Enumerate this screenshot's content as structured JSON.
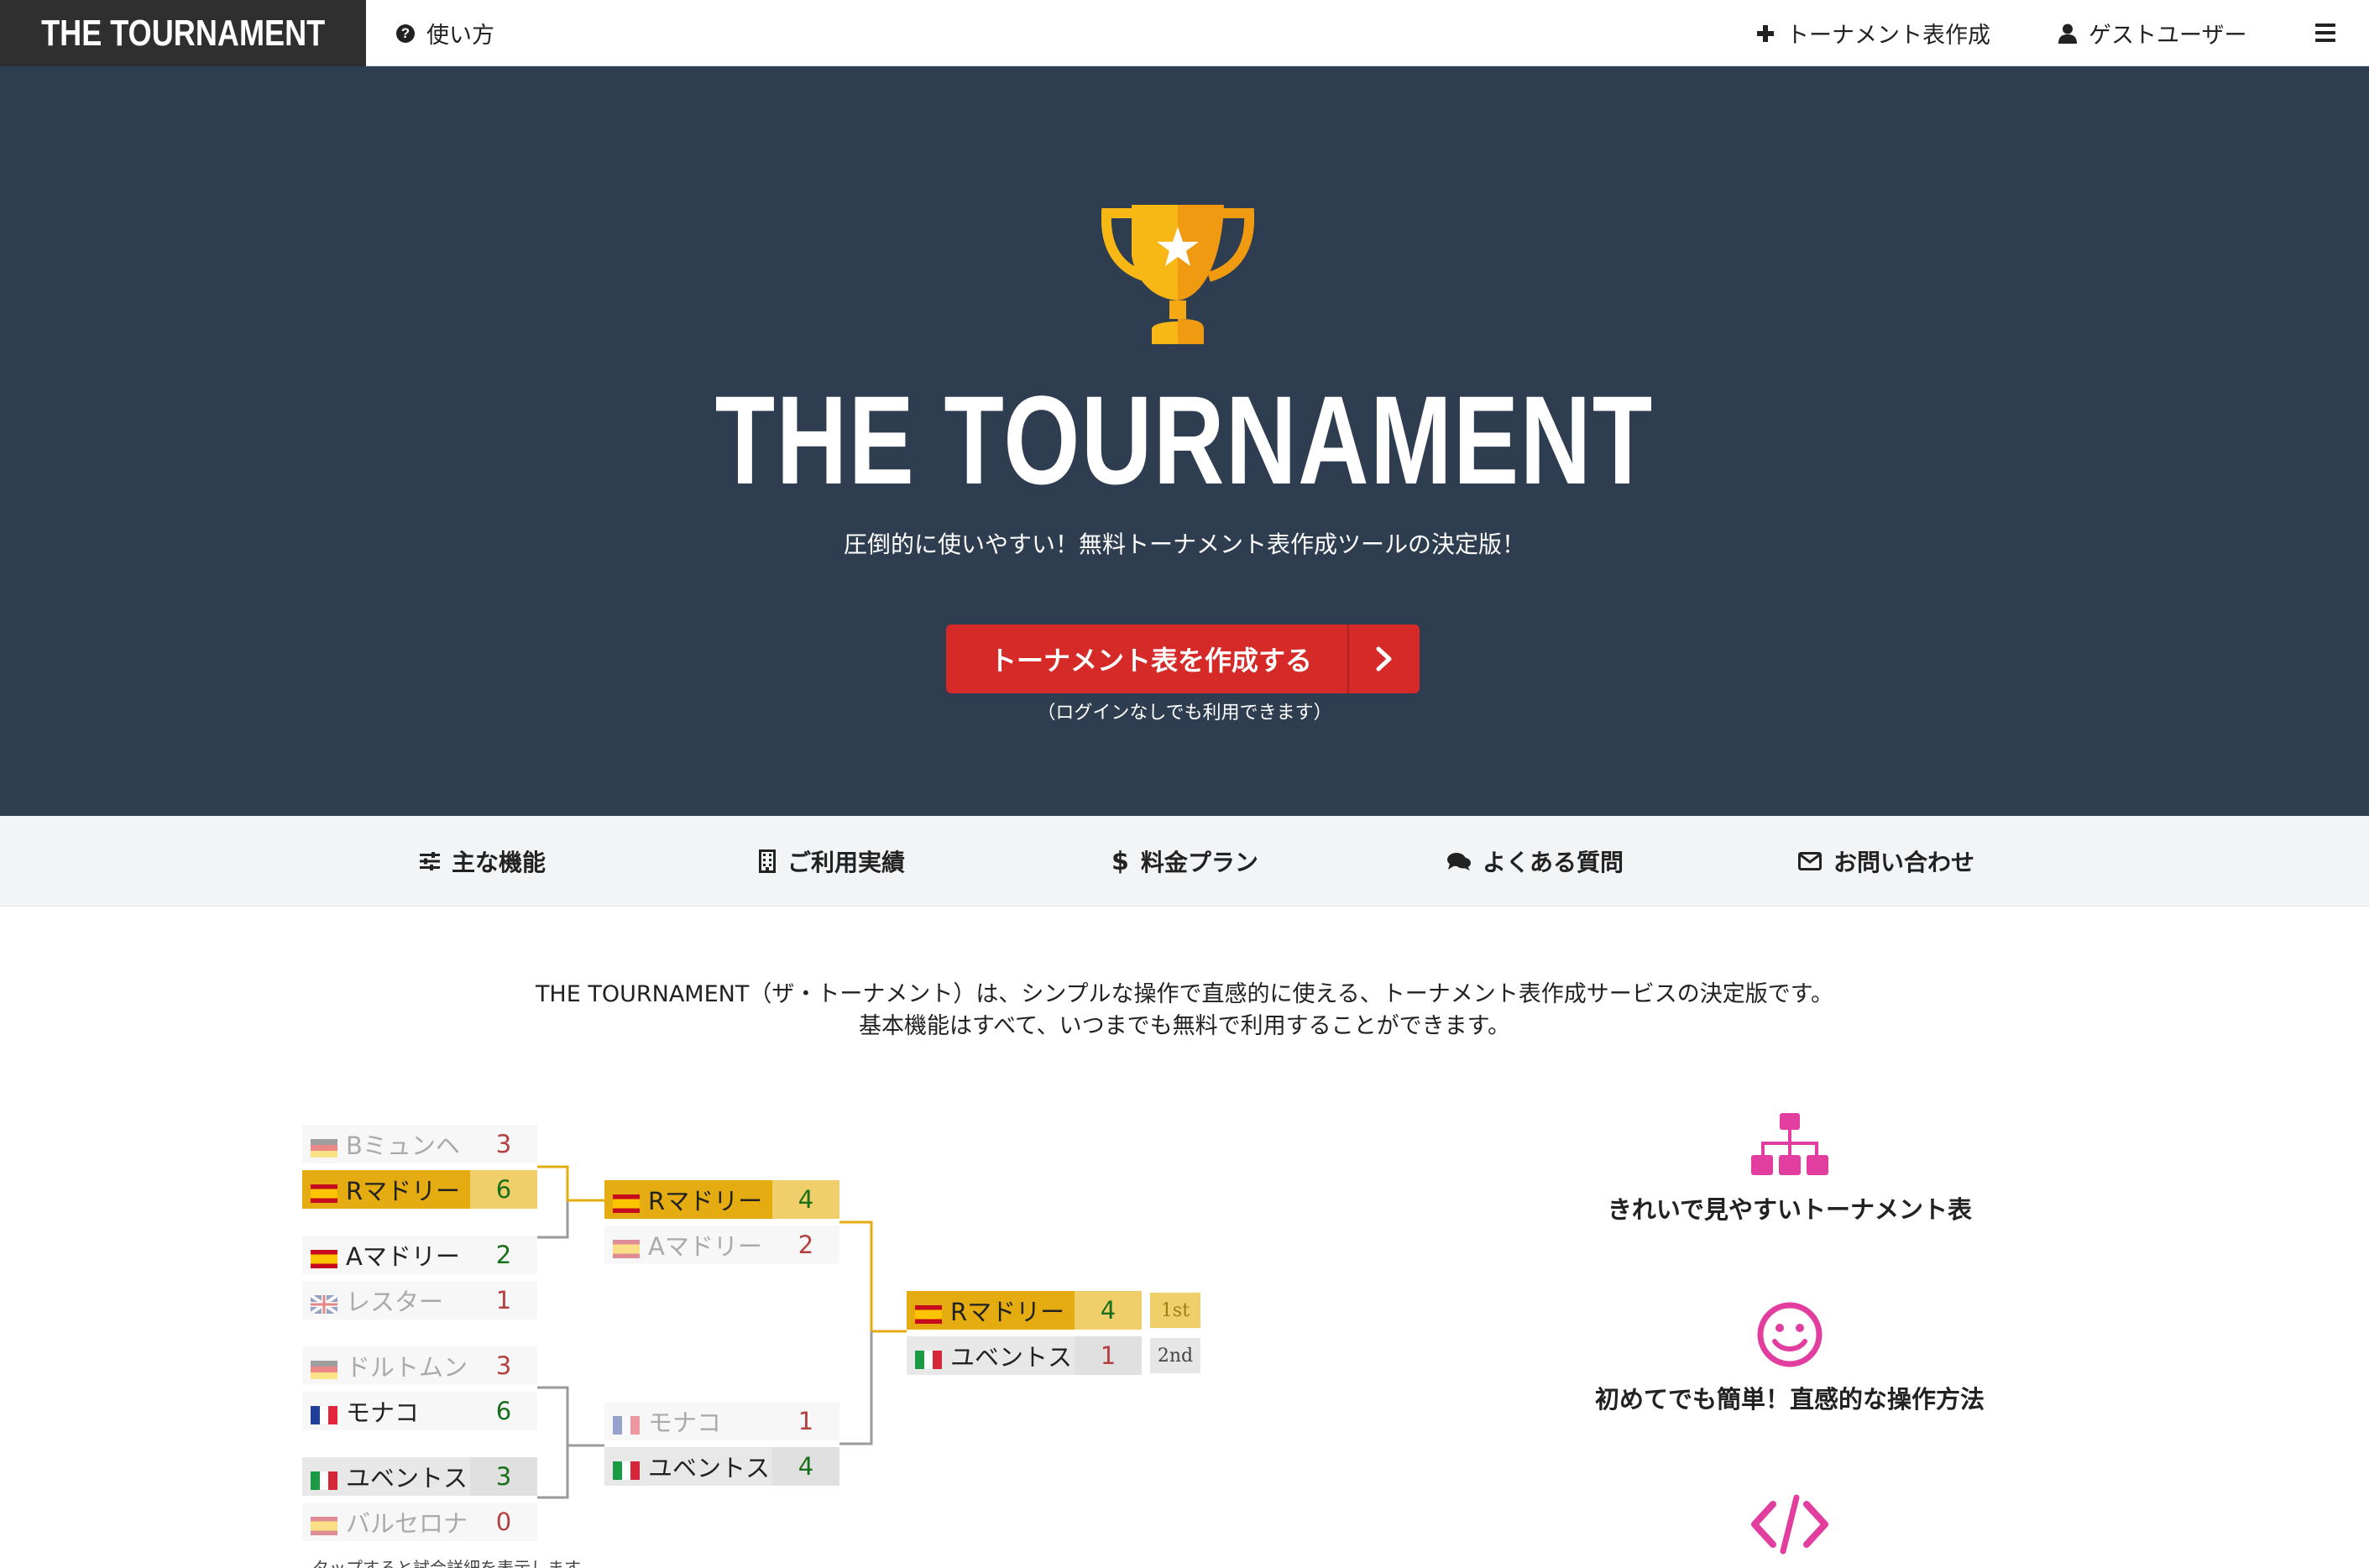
{
  "nav": {
    "brand": "THE TOURNAMENT",
    "help": "使い方",
    "create": "トーナメント表作成",
    "user": "ゲストユーザー",
    "menu_icon": "hamburger-menu-icon"
  },
  "hero": {
    "title": "THE TOURNAMENT",
    "subtitle": "圧倒的に使いやすい！無料トーナメント表作成ツールの決定版！",
    "cta": "トーナメント表を作成する",
    "cta_note": "（ログインなしでも利用できます）",
    "background": "#2e3d4f",
    "cta_color": "#d52a28",
    "trophy_colors": [
      "#f7b815",
      "#f09a12"
    ]
  },
  "subnav": {
    "items": [
      {
        "label": "主な機能",
        "icon": "sliders-icon"
      },
      {
        "label": "ご利用実績",
        "icon": "building-icon"
      },
      {
        "label": "料金プラン",
        "icon": "dollar-icon"
      },
      {
        "label": "よくある質問",
        "icon": "comments-icon"
      },
      {
        "label": "お問い合わせ",
        "icon": "envelope-icon"
      }
    ]
  },
  "intro": {
    "line1": "THE TOURNAMENT（ザ・トーナメント）は、シンプルな操作で直感的に使える、トーナメント表作成サービスの決定版です。",
    "line2": "基本機能はすべて、いつまでも無料で利用することができます。"
  },
  "bracket": {
    "round1": [
      {
        "name": "Bミュンヘ",
        "score": "3",
        "flag": "de",
        "state": "lose"
      },
      {
        "name": "Rマドリー",
        "score": "6",
        "flag": "es",
        "state": "champ"
      },
      {
        "name": "Aマドリー",
        "score": "2",
        "flag": "es",
        "state": "win"
      },
      {
        "name": "レスター",
        "score": "1",
        "flag": "gb",
        "state": "lose"
      },
      {
        "name": "ドルトムン",
        "score": "3",
        "flag": "de",
        "state": "lose"
      },
      {
        "name": "モナコ",
        "score": "6",
        "flag": "fr",
        "state": "win"
      },
      {
        "name": "ユベントス",
        "score": "3",
        "flag": "it",
        "state": "win"
      },
      {
        "name": "バルセロナ",
        "score": "0",
        "flag": "es",
        "state": "lose"
      }
    ],
    "round2": [
      {
        "name": "Rマドリー",
        "score": "4",
        "flag": "es",
        "state": "champ"
      },
      {
        "name": "Aマドリー",
        "score": "2",
        "flag": "es",
        "state": "lose"
      },
      {
        "name": "モナコ",
        "score": "1",
        "flag": "fr",
        "state": "lose"
      },
      {
        "name": "ユベントス",
        "score": "4",
        "flag": "it",
        "state": "win"
      }
    ],
    "final": [
      {
        "name": "Rマドリー",
        "score": "4",
        "flag": "es",
        "state": "champ",
        "rank": "1st"
      },
      {
        "name": "ユベントス",
        "score": "1",
        "flag": "it",
        "state": "win",
        "rank": "2nd"
      }
    ],
    "note": "タップすると試合詳細を表示します",
    "champion_color": "#e4ac11",
    "line_color_champion": "#e4ac11",
    "line_color_other": "#9a9a9a"
  },
  "features": [
    {
      "label": "きれいで見やすいトーナメント表",
      "icon": "sitemap-icon"
    },
    {
      "label": "初めてでも簡単！直感的な操作方法",
      "icon": "smile-icon"
    },
    {
      "label": "",
      "icon": "code-icon"
    }
  ],
  "accent_color": "#e23e9f"
}
